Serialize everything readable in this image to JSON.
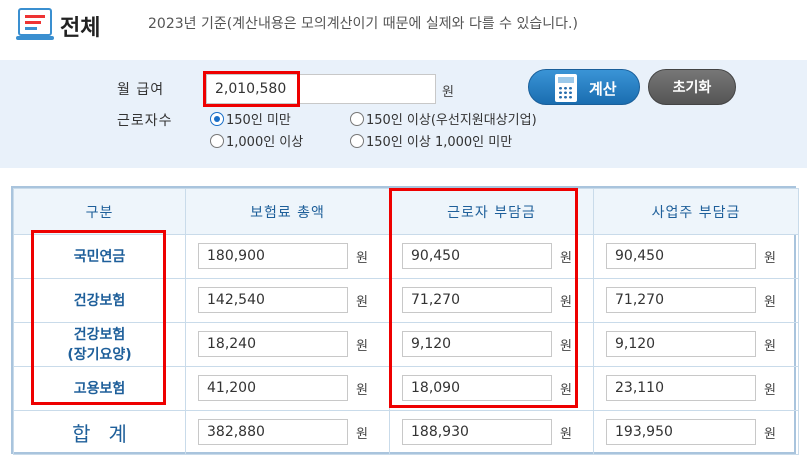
{
  "header": {
    "icon": "document-list-icon",
    "title": "전체",
    "notice": "2023년 기준(계산내용은 모의계산이기 때문에 실제와 다를 수 있습니다.)"
  },
  "form": {
    "salary_label": "월 급여",
    "salary_value": "2,010,580",
    "won_unit": "원",
    "workers_label": "근로자수",
    "options": [
      {
        "label": "150인 미만",
        "selected": true
      },
      {
        "label": "150인 이상(우선지원대상기업)",
        "selected": false
      },
      {
        "label": "1,000인 이상",
        "selected": false
      },
      {
        "label": "150인 이상 1,000인 미만",
        "selected": false
      }
    ],
    "calc_button": "계산",
    "calc_icon": "calculator-icon",
    "reset_button": "초기화"
  },
  "table": {
    "headers": [
      "구분",
      "보험료 총액",
      "근로자 부담금",
      "사업주 부담금"
    ],
    "won_unit": "원",
    "rows": [
      {
        "category": "국민연금",
        "category_line2": "",
        "total": "180,900",
        "employee": "90,450",
        "employer": "90,450"
      },
      {
        "category": "건강보험",
        "category_line2": "",
        "total": "142,540",
        "employee": "71,270",
        "employer": "71,270"
      },
      {
        "category": "건강보험",
        "category_line2": "(장기요양)",
        "total": "18,240",
        "employee": "9,120",
        "employer": "9,120"
      },
      {
        "category": "고용보험",
        "category_line2": "",
        "total": "41,200",
        "employee": "18,090",
        "employer": "23,110"
      }
    ],
    "sum_row": {
      "label": "합계",
      "total": "382,880",
      "employee": "188,930",
      "employer": "193,950"
    }
  },
  "highlight_color": "#e00000",
  "accent_color": "#1e5f9a"
}
